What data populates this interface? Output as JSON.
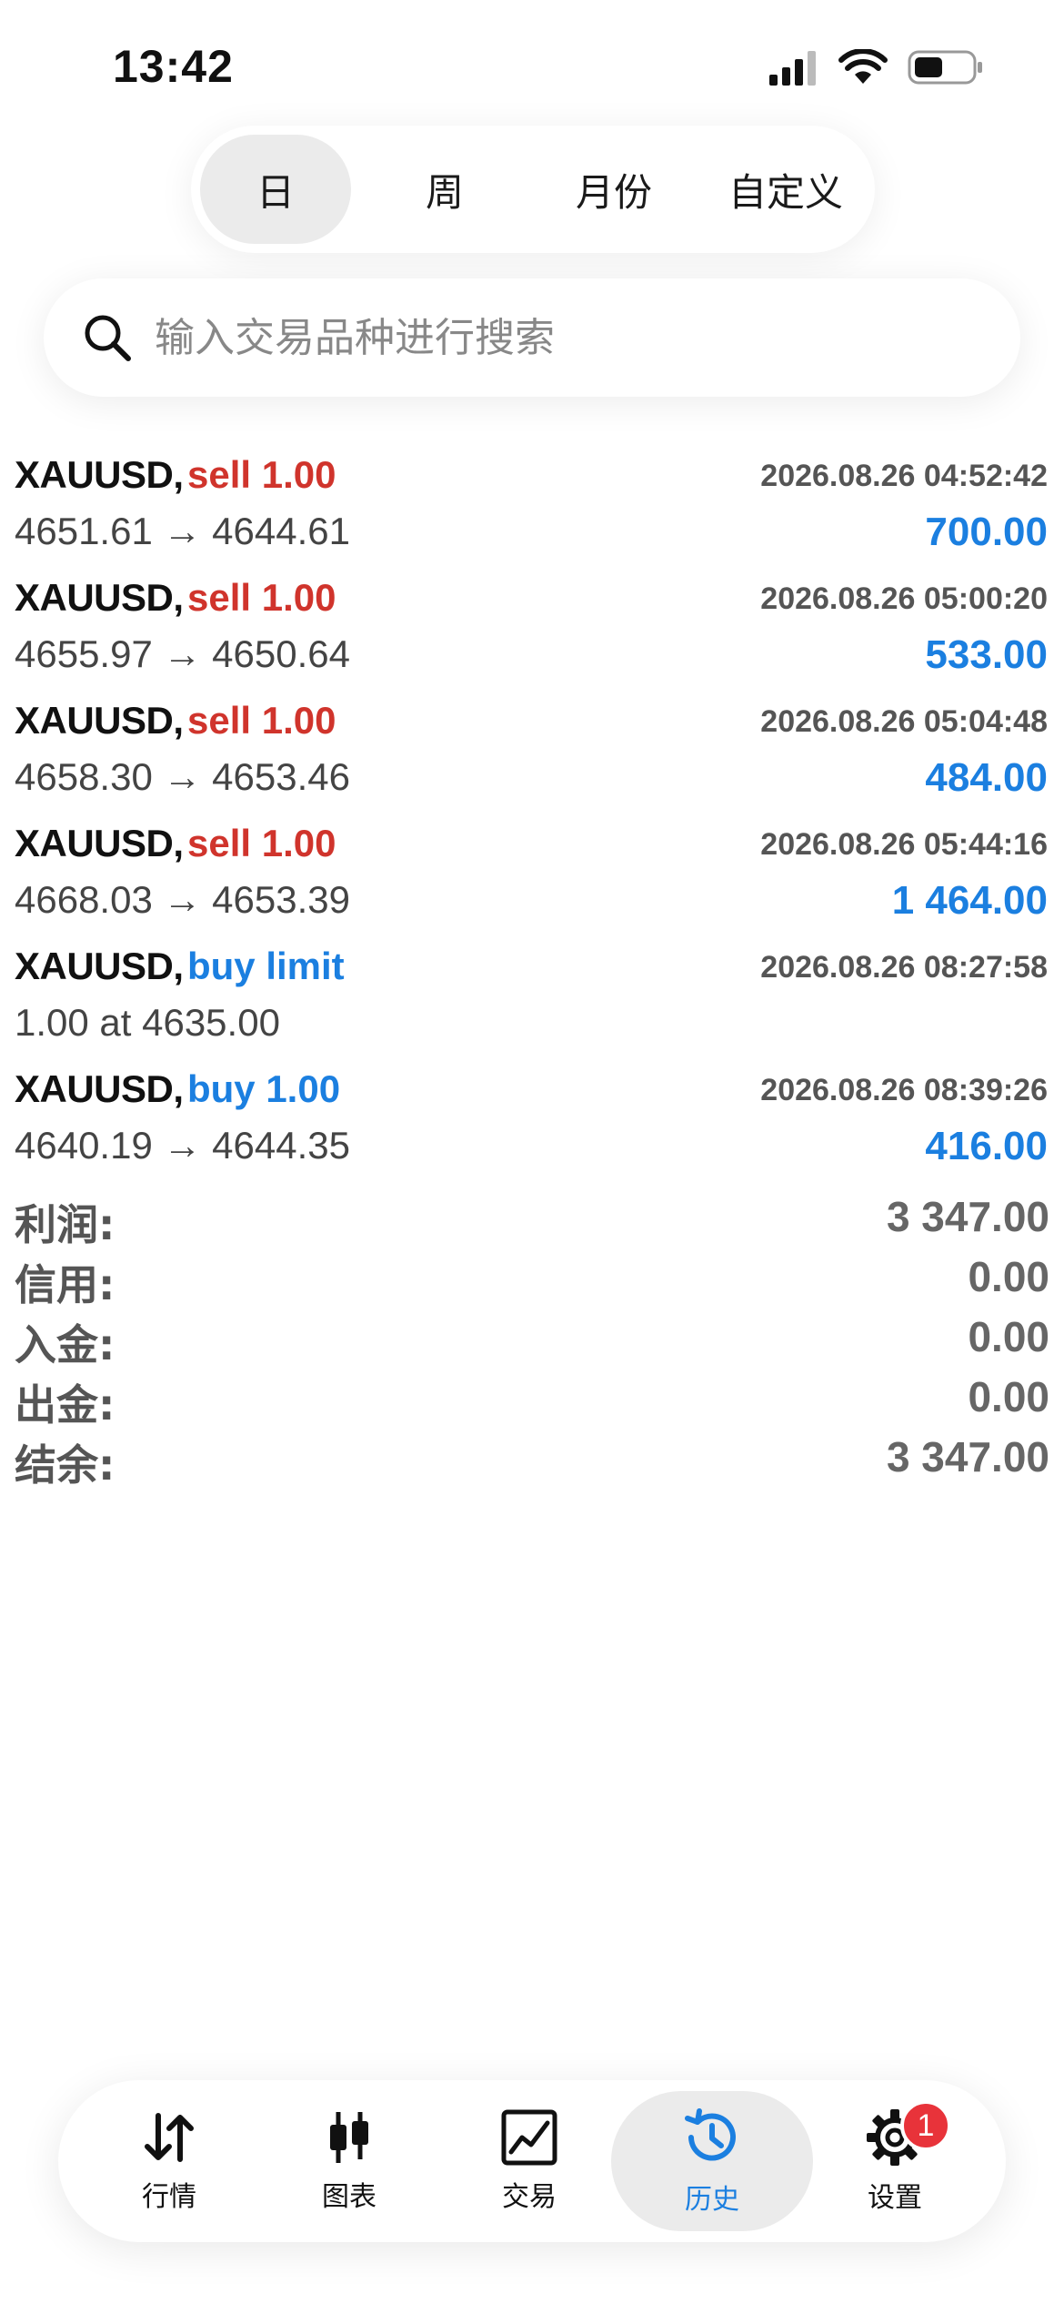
{
  "status_bar": {
    "time": "13:42"
  },
  "period_tabs": [
    {
      "label": "日",
      "active": true
    },
    {
      "label": "周",
      "active": false
    },
    {
      "label": "月份",
      "active": false
    },
    {
      "label": "自定义",
      "active": false
    }
  ],
  "search": {
    "placeholder": "输入交易品种进行搜索",
    "value": ""
  },
  "trades": [
    {
      "symbol": "XAUUSD,",
      "side": "sell 1.00",
      "time": "2026.08.26 04:52:42",
      "prices": "4651.61 → 4644.61",
      "profit": "700.00"
    },
    {
      "symbol": "XAUUSD,",
      "side": "sell 1.00",
      "time": "2026.08.26 05:00:20",
      "prices": "4655.97 → 4650.64",
      "profit": "533.00"
    },
    {
      "symbol": "XAUUSD,",
      "side": "sell 1.00",
      "time": "2026.08.26 05:04:48",
      "prices": "4658.30 → 4653.46",
      "profit": "484.00"
    },
    {
      "symbol": "XAUUSD,",
      "side": "sell 1.00",
      "time": "2026.08.26 05:44:16",
      "prices": "4668.03 → 4653.39",
      "profit": "1 464.00"
    },
    {
      "symbol": "XAUUSD,",
      "side": "buy limit",
      "time": "2026.08.26 08:27:58",
      "prices": "1.00 at 4635.00",
      "profit": ""
    },
    {
      "symbol": "XAUUSD,",
      "side": "buy 1.00",
      "time": "2026.08.26 08:39:26",
      "prices": "4640.19 → 4644.35",
      "profit": "416.00"
    }
  ],
  "summary": [
    {
      "label": "利润:",
      "value": "3 347.00"
    },
    {
      "label": "信用:",
      "value": "0.00"
    },
    {
      "label": "入金:",
      "value": "0.00"
    },
    {
      "label": "出金:",
      "value": "0.00"
    },
    {
      "label": "结余:",
      "value": "3 347.00"
    }
  ],
  "bottom_nav": [
    {
      "label": "行情",
      "icon": "quotes-arrows-icon",
      "active": false
    },
    {
      "label": "图表",
      "icon": "candlestick-chart-icon",
      "active": false
    },
    {
      "label": "交易",
      "icon": "trade-chart-icon",
      "active": false
    },
    {
      "label": "历史",
      "icon": "history-clock-icon",
      "active": true
    },
    {
      "label": "设置",
      "icon": "gear-icon",
      "active": false,
      "badge": "1"
    }
  ],
  "colors": {
    "sell": "#d0342c",
    "buy": "#1b7fe0",
    "profit": "#1b7fe0",
    "badge": "#e8333a"
  }
}
